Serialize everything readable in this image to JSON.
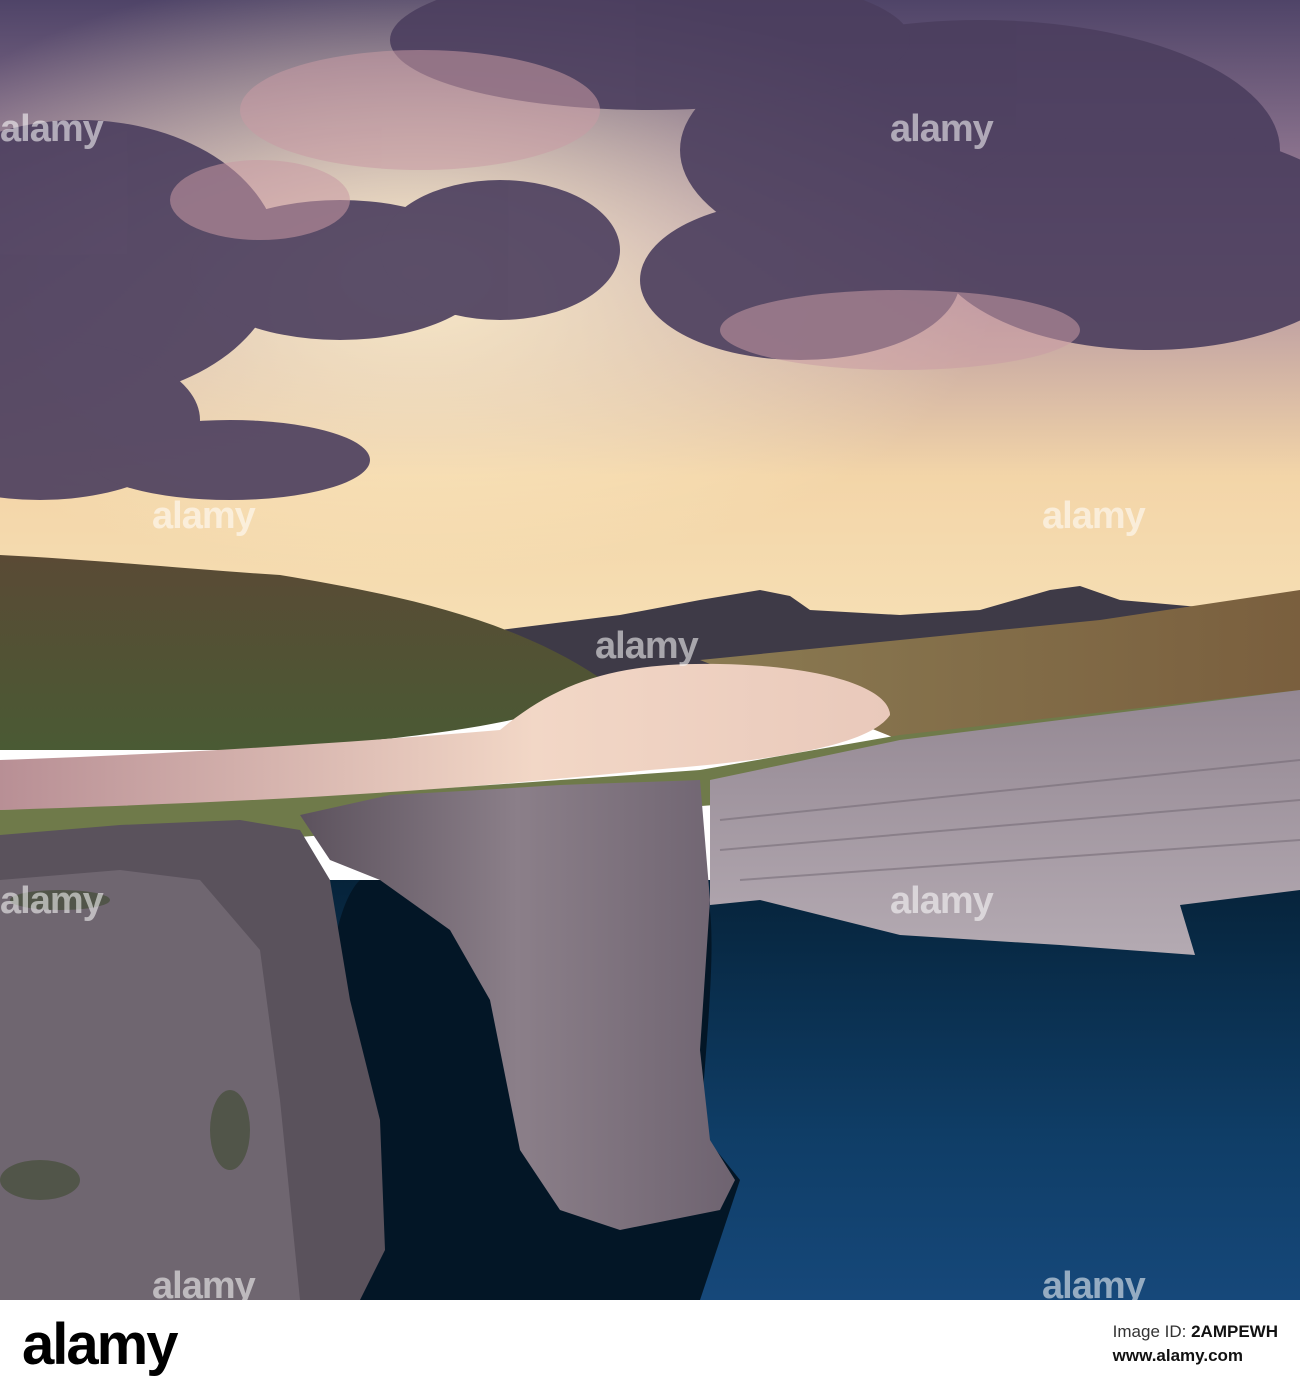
{
  "photo": {
    "subject": "cliffs",
    "colors": {
      "sky_top": "#5a4a6e",
      "sky_glow": "#f6d9a8",
      "cloud": "#4c3f5f",
      "hill": "#6b5a3a",
      "lake": "#e9c6b8",
      "cliff": "#7e7480",
      "sea": "#0d2f4d"
    },
    "watermark": "alamy"
  },
  "footer": {
    "brand": "alamy",
    "image_id_label": "Image ID:",
    "image_id": "2AMPEWH",
    "site": "www.alamy.com"
  }
}
